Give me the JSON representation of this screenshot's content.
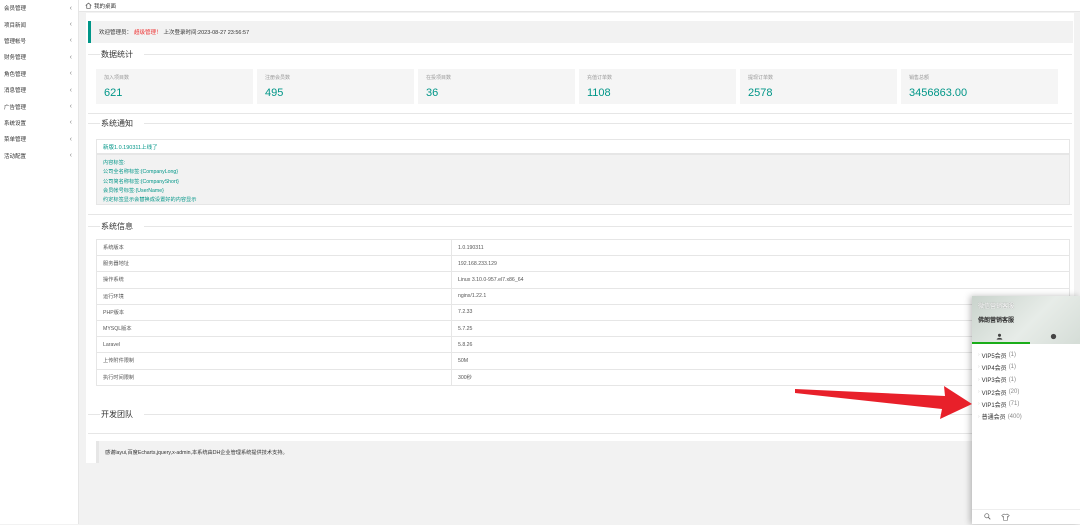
{
  "sidebar": {
    "items": [
      {
        "label": "会员管理"
      },
      {
        "label": "项目新闻"
      },
      {
        "label": "管理帐号"
      },
      {
        "label": "财务管理"
      },
      {
        "label": "角色管理"
      },
      {
        "label": "消息管理"
      },
      {
        "label": "广告管理"
      },
      {
        "label": "系统设置"
      },
      {
        "label": "菜单管理"
      },
      {
        "label": "活动配置"
      }
    ]
  },
  "tabbar": {
    "home_label": "我的桌面"
  },
  "welcome": {
    "prefix": "欢迎管理员：",
    "role": "超级管理！",
    "last_login": "上次登录时间:2023-08-27 23:56:57"
  },
  "stats": {
    "title": "数据统计",
    "cards": [
      {
        "label": "加入项目数",
        "value": "621"
      },
      {
        "label": "注册会员数",
        "value": "495"
      },
      {
        "label": "在投项目数",
        "value": "36"
      },
      {
        "label": "充值订单数",
        "value": "1108"
      },
      {
        "label": "提现订单数",
        "value": "2578"
      },
      {
        "label": "销售总额",
        "value": "3456863.00"
      }
    ]
  },
  "notice": {
    "title": "系统通知",
    "headline": "新版1.0.190311上线了",
    "lines": [
      "内容标签:",
      "公司全名称标签:{CompanyLong}",
      "公司简名称标签:{CompanyShort}",
      "会员帐号标签:{UserName}",
      "约定标签显示会替换成设置好的内容显示"
    ]
  },
  "sysinfo": {
    "title": "系统信息",
    "rows": [
      {
        "key": "系统版本",
        "value": "1.0.190311"
      },
      {
        "key": "服务器地址",
        "value": "192.168.233.129"
      },
      {
        "key": "操作系统",
        "value": "Linux 3.10.0-957.el7.x86_64"
      },
      {
        "key": "运行环境",
        "value": "nginx/1.22.1"
      },
      {
        "key": "PHP版本",
        "value": "7.2.33"
      },
      {
        "key": "MYSQL版本",
        "value": "5.7.25"
      },
      {
        "key": "Laravel",
        "value": "5.8.26"
      },
      {
        "key": "上传附件限制",
        "value": "50M"
      },
      {
        "key": "执行时间限制",
        "value": "300秒"
      }
    ]
  },
  "team": {
    "title": "开发团队",
    "text": "感谢layui,百度Echarts,jquery,x-admin,本系统由DH企业管理系统提供技术支持。"
  },
  "overlay": {
    "title": "微信营销客服",
    "subtitle": "佛朗营销客服",
    "members": [
      {
        "name": "VIP5会员",
        "count": "(1)"
      },
      {
        "name": "VIP4会员",
        "count": "(1)"
      },
      {
        "name": "VIP3会员",
        "count": "(1)"
      },
      {
        "name": "VIP2会员",
        "count": "(20)"
      },
      {
        "name": "VIP1会员",
        "count": "(71)"
      },
      {
        "name": "普通会员",
        "count": "(400)"
      }
    ]
  },
  "colors": {
    "accent": "#009688",
    "role": "#e33333",
    "arrow": "#e8202a"
  },
  "icons": {
    "home": "home-icon",
    "chevron": "chevron-left-icon",
    "user": "user-icon",
    "chat": "chat-icon",
    "search": "search-icon",
    "shirt": "shirt-icon"
  }
}
